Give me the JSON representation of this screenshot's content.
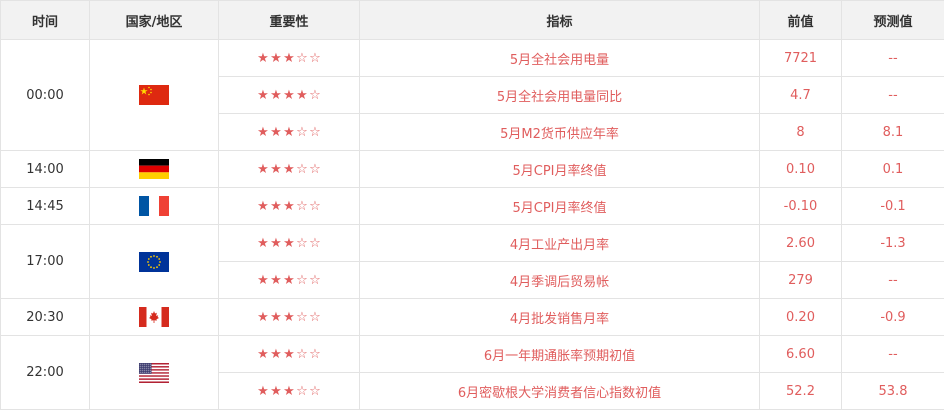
{
  "headers": {
    "time": "时间",
    "country": "国家/地区",
    "importance": "重要性",
    "indicator": "指标",
    "previous": "前值",
    "forecast": "预测值"
  },
  "colors": {
    "accent": "#e05d5d",
    "header_bg": "#f2f2f2",
    "border": "#e3e3e3"
  },
  "groups": [
    {
      "time": "00:00",
      "country": "china",
      "flag_icon": "china-flag-icon",
      "rows": [
        {
          "stars": 3,
          "name": "5月全社会用电量",
          "prev": "7721",
          "forecast": "--"
        },
        {
          "stars": 4,
          "name": "5月全社会用电量同比",
          "prev": "4.7",
          "forecast": "--"
        },
        {
          "stars": 3,
          "name": "5月M2货币供应年率",
          "prev": "8",
          "forecast": "8.1"
        }
      ]
    },
    {
      "time": "14:00",
      "country": "germany",
      "flag_icon": "germany-flag-icon",
      "rows": [
        {
          "stars": 3,
          "name": "5月CPI月率终值",
          "prev": "0.10",
          "forecast": "0.1"
        }
      ]
    },
    {
      "time": "14:45",
      "country": "france",
      "flag_icon": "france-flag-icon",
      "rows": [
        {
          "stars": 3,
          "name": "5月CPI月率终值",
          "prev": "-0.10",
          "forecast": "-0.1"
        }
      ]
    },
    {
      "time": "17:00",
      "country": "eu",
      "flag_icon": "eu-flag-icon",
      "rows": [
        {
          "stars": 3,
          "name": "4月工业产出月率",
          "prev": "2.60",
          "forecast": "-1.3"
        },
        {
          "stars": 3,
          "name": "4月季调后贸易帐",
          "prev": "279",
          "forecast": "--"
        }
      ]
    },
    {
      "time": "20:30",
      "country": "canada",
      "flag_icon": "canada-flag-icon",
      "rows": [
        {
          "stars": 3,
          "name": "4月批发销售月率",
          "prev": "0.20",
          "forecast": "-0.9"
        }
      ]
    },
    {
      "time": "22:00",
      "country": "usa",
      "flag_icon": "usa-flag-icon",
      "rows": [
        {
          "stars": 3,
          "name": "6月一年期通胀率预期初值",
          "prev": "6.60",
          "forecast": "--"
        },
        {
          "stars": 3,
          "name": "6月密歇根大学消费者信心指数初值",
          "prev": "52.2",
          "forecast": "53.8"
        }
      ]
    }
  ]
}
